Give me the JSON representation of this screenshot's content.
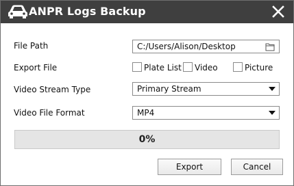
{
  "dialog": {
    "title": "ANPR Logs Backup",
    "title_icon": "car-icon",
    "close_icon": "close-icon"
  },
  "file_path": {
    "label": "File Path",
    "value": "C:/Users/Alison/Desktop",
    "icon": "folder-icon"
  },
  "export_file": {
    "label": "Export File",
    "options": [
      {
        "label": "Plate List",
        "checked": false
      },
      {
        "label": "Video",
        "checked": false
      },
      {
        "label": "Picture",
        "checked": false
      }
    ]
  },
  "video_stream_type": {
    "label": "Video Stream Type",
    "selected": "Primary Stream"
  },
  "video_file_format": {
    "label": "Video File Format",
    "selected": "MP4"
  },
  "progress": {
    "value": 0,
    "text": "0%"
  },
  "buttons": {
    "export": "Export",
    "cancel": "Cancel"
  },
  "colors": {
    "titlebar": "#3f3f3f",
    "progress_track": "#e5e5e5"
  }
}
